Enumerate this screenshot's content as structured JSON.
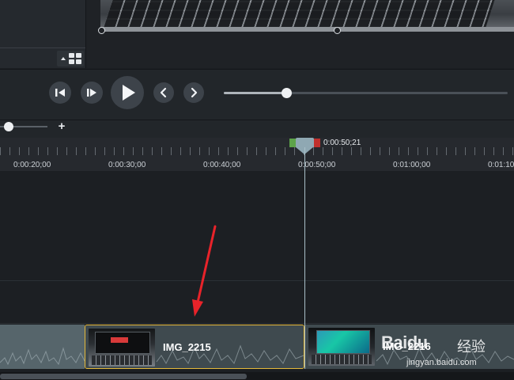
{
  "panel": {
    "grid_button_icon": "grid-icon"
  },
  "playback": {
    "step_back_icon": "step-back-icon",
    "step_forward_icon": "step-forward-icon",
    "play_icon": "play-icon",
    "previous_icon": "chevron-left-icon",
    "next_icon": "chevron-right-icon",
    "scrubber_progress": 0.22
  },
  "zoom": {
    "zoom_in_label": "+",
    "level": 0.1
  },
  "timeline": {
    "playhead_time": "0:00:50;21",
    "ruler_labels": [
      "0:00:20;00",
      "0:00:30;00",
      "0:00:40;00",
      "0:00:50;00",
      "0:01:00;00",
      "0:01:10"
    ],
    "colors": {
      "selection_start": "#5da349",
      "selection_end": "#c0302c",
      "playhead": "#8fa8b3",
      "selected_clip_border": "#e5b93a",
      "annotation_arrow": "#e8232a"
    }
  },
  "clips": [
    {
      "name": "IMG_2215",
      "selected": true
    },
    {
      "name": "IMG_2216",
      "selected": false
    }
  ],
  "watermark": {
    "brand": "Baidu",
    "brand_cn": "经验",
    "url": "jingyan.baidu.com"
  }
}
